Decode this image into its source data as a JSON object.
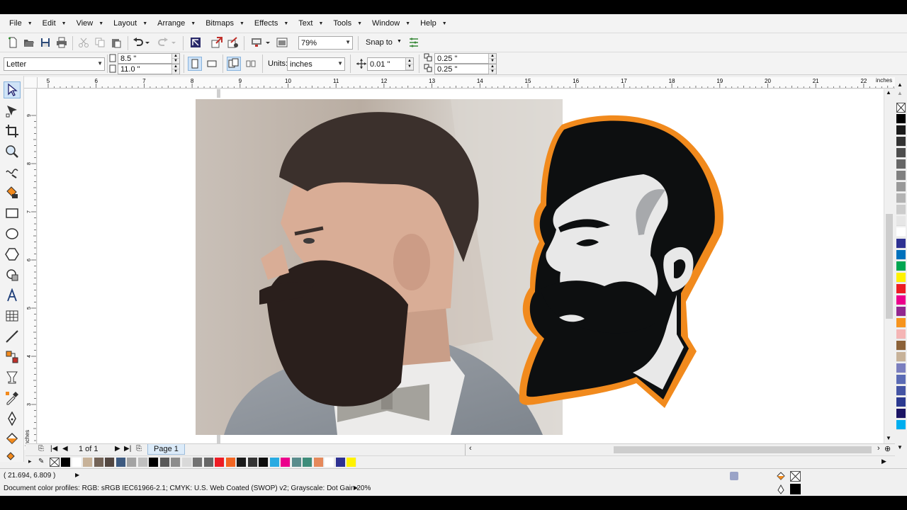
{
  "menu": [
    {
      "label": "File"
    },
    {
      "label": "Edit"
    },
    {
      "label": "View"
    },
    {
      "label": "Layout"
    },
    {
      "label": "Arrange"
    },
    {
      "label": "Bitmaps"
    },
    {
      "label": "Effects"
    },
    {
      "label": "Text"
    },
    {
      "label": "Tools"
    },
    {
      "label": "Window"
    },
    {
      "label": "Help"
    }
  ],
  "standard_toolbar": {
    "zoom_level": "79%",
    "snap_to_label": "Snap to"
  },
  "property_bar": {
    "page_size": "Letter",
    "page_width": "8.5 \"",
    "page_height": "11.0 \"",
    "units_label": "Units:",
    "units_value": "inches",
    "nudge_distance": "0.01 \"",
    "duplicate_x": "0.25 \"",
    "duplicate_y": "0.25 \""
  },
  "rulers": {
    "horizontal_ticks": [
      "5",
      "6",
      "7",
      "8",
      "9",
      "10",
      "11",
      "12",
      "13",
      "14",
      "15",
      "16",
      "17",
      "18",
      "19",
      "20",
      "21",
      "22"
    ],
    "unit_label": "inches",
    "vertical_ticks": [
      "9",
      "8",
      "7",
      "6",
      "5",
      "4",
      "3",
      "2",
      "1"
    ],
    "vertical_unit_label": "inches"
  },
  "page_nav": {
    "page_count": "1 of 1",
    "page_tab": "Page 1"
  },
  "palette_colors": {
    "vertical": [
      "#000000",
      "#1a1a1a",
      "#333333",
      "#4d4d4d",
      "#666666",
      "#808080",
      "#999999",
      "#b3b3b3",
      "#cccccc",
      "#e6e6e6",
      "#ffffff",
      "#2e3192",
      "#0071bc",
      "#00a651",
      "#fff200",
      "#ed1c24",
      "#ec008c",
      "#92278f",
      "#f7941d",
      "#f5b5b5",
      "#8c6239",
      "#c7b299",
      "#7b7fbf",
      "#5b6bb5",
      "#4454a4",
      "#2b3990",
      "#1b1464",
      "#00aeef"
    ],
    "horizontal": [
      "#000000",
      "#ffffff",
      "#c7b299",
      "#736357",
      "#534741",
      "#3d5a80",
      "#a3a3a3",
      "#bfbfbf",
      "#000000",
      "#595959",
      "#8c8c8c",
      "#d9d9d9",
      "#737373",
      "#666666",
      "#ed1c24",
      "#f26522",
      "#1a1a1a",
      "#333333",
      "#0d0d0d",
      "#29abe2",
      "#ec008c",
      "#598c8c",
      "#3e8c7a",
      "#e5895b",
      "#ffffff",
      "#2e3192",
      "#fff200"
    ]
  },
  "status": {
    "coordinates": "( 21.694, 6.809  )",
    "color_profiles": "Document color profiles: RGB: sRGB IEC61966-2.1; CMYK: U.S. Web Coated (SWOP) v2; Grayscale: Dot Gain 20%"
  },
  "colors": {
    "accent_orange": "#f18a1d",
    "logo_dark": "#0d0f10",
    "logo_light": "#e8e8e8",
    "logo_mid": "#a7a9ac"
  }
}
